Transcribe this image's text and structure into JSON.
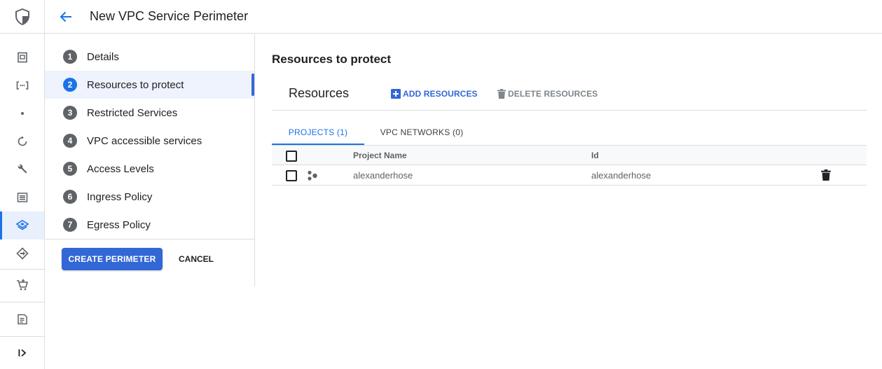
{
  "header": {
    "title": "New VPC Service Perimeter"
  },
  "rail": {
    "icons": [
      "security-shield-icon",
      "dashboard-icon",
      "code-brackets-icon",
      "dot-icon",
      "refresh-icon",
      "wrench-icon",
      "list-icon",
      "layers-icon",
      "diamond-arrow-icon",
      "cart-icon",
      "notes-icon",
      "expand-icon"
    ]
  },
  "steps": [
    {
      "num": "1",
      "label": "Details"
    },
    {
      "num": "2",
      "label": "Resources to protect"
    },
    {
      "num": "3",
      "label": "Restricted Services"
    },
    {
      "num": "4",
      "label": "VPC accessible services"
    },
    {
      "num": "5",
      "label": "Access Levels"
    },
    {
      "num": "6",
      "label": "Ingress Policy"
    },
    {
      "num": "7",
      "label": "Egress Policy"
    }
  ],
  "buttons": {
    "create": "CREATE PERIMETER",
    "cancel": "CANCEL"
  },
  "main": {
    "section_title": "Resources to protect",
    "resources_title": "Resources",
    "add_label": "ADD RESOURCES",
    "delete_label": "DELETE RESOURCES",
    "tabs": [
      {
        "label": "PROJECTS (1)"
      },
      {
        "label": "VPC NETWORKS (0)"
      }
    ],
    "table": {
      "headers": {
        "name": "Project Name",
        "id": "Id"
      },
      "rows": [
        {
          "name": "alexanderhose",
          "id": "alexanderhose"
        }
      ]
    }
  },
  "colors": {
    "accent": "#1a73e8",
    "primary_button": "#3367d6"
  }
}
